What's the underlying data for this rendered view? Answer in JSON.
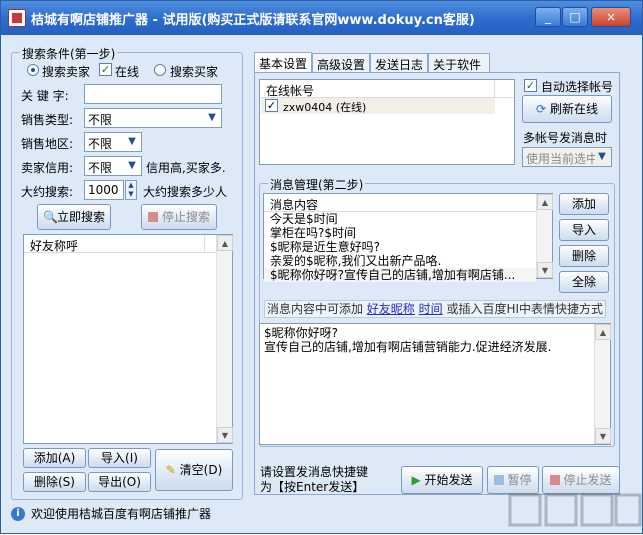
{
  "window": {
    "title": "桔城有啊店铺推广器 - 试用版(购买正式版请联系官网www.dokuy.cn客服)",
    "minimize": "_",
    "maximize": "□",
    "close": "×"
  },
  "search": {
    "group_title": "搜索条件(第一步)",
    "radio_sellers": "搜索卖家",
    "online_label": "在线",
    "radio_buyers": "搜索买家",
    "keyword_label": "关 键 字:",
    "keyword_value": "",
    "sales_type_label": "销售类型:",
    "sales_type_value": "不限",
    "sales_area_label": "销售地区:",
    "sales_area_value": "不限",
    "seller_credit_label": "卖家信用:",
    "seller_credit_value": "不限",
    "credit_hint": "信用高,买家多.",
    "approx_label": "大约搜索:",
    "approx_value": "1000",
    "approx_hint": "大约搜索多少人",
    "search_now": "立即搜索",
    "stop_search": "停止搜索"
  },
  "friends": {
    "column": "好友称呼",
    "add": "添加(A)",
    "import": "导入(I)",
    "delete": "删除(S)",
    "export": "导出(O)",
    "clear": "清空(D)"
  },
  "tabs": [
    "基本设置",
    "高级设置",
    "发送日志",
    "关于软件"
  ],
  "accounts": {
    "column": "在线帐号",
    "items": [
      "zxw0404 (在线)"
    ],
    "auto_select": "自动选择帐号",
    "refresh_online": "刷新在线",
    "multi_label": "多帐号发消息时",
    "multi_value": "使用当前选中"
  },
  "messages": {
    "group_title": "消息管理(第二步)",
    "column": "消息内容",
    "items": [
      "今天是$时间",
      "掌柜在吗?$时间",
      "$昵称是近生意好吗?",
      "亲爱的$昵称,我们又出新产品咯.",
      "$昵称你好呀?宣传自己的店铺,增加有啊店铺..."
    ],
    "add": "添加",
    "import": "导入",
    "delete": "删除",
    "select_all": "全除",
    "hint_prefix": "消息内容中可添加",
    "hint_nick": "好友昵称",
    "hint_time": "时间",
    "hint_suffix": "或插入百度HI中表情快捷方式",
    "editor_lines": [
      "$昵称你好呀?",
      "宣传自己的店铺,增加有啊店铺营销能力.促进经济发展."
    ]
  },
  "send": {
    "shortcut_line1": "请设置发消息快捷键",
    "shortcut_line2": "为【按Enter发送】",
    "start": "开始发送",
    "pause": "暂停",
    "stop": "停止发送"
  },
  "status": {
    "text": "欢迎使用桔城百度有啊店铺推广器"
  }
}
